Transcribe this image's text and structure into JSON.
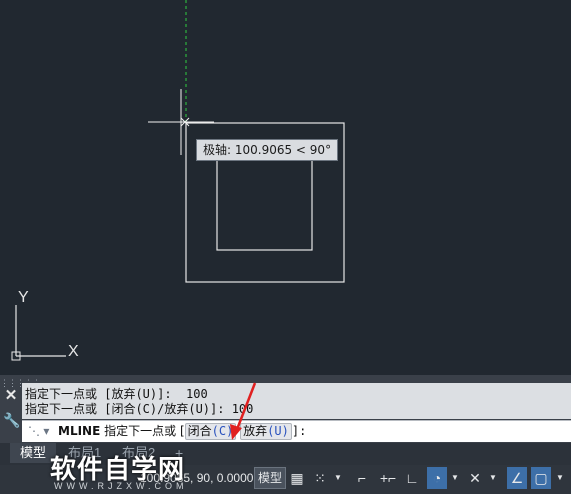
{
  "tooltip": {
    "label": "极轴: 100.9065 < 90°"
  },
  "ucs": {
    "y_label": "Y",
    "x_label": "X"
  },
  "command": {
    "history": [
      "指定下一点或 [放弃(U)]:  100",
      "指定下一点或 [闭合(C)/放弃(U)]: 100"
    ],
    "prompt_command": "MLINE",
    "prompt_text": "指定下一点或 [",
    "option_close": "闭合",
    "option_close_key": "(C)",
    "option_undo": "放弃",
    "option_undo_key": "(U)",
    "prompt_end": "]:"
  },
  "tabs": {
    "model": "模型",
    "layout1": "布局1",
    "layout2": "布局2",
    "add": "+"
  },
  "status": {
    "coordinates": "100.9065, 90, 0.0000",
    "model_button": "模型"
  },
  "watermark": {
    "title": "软件自学网",
    "url": "WWW.RJZXW.COM"
  },
  "colors": {
    "canvas": "#212830",
    "polar_tracking_line": "#2ecc40",
    "active_status": "#3d6fa8"
  }
}
